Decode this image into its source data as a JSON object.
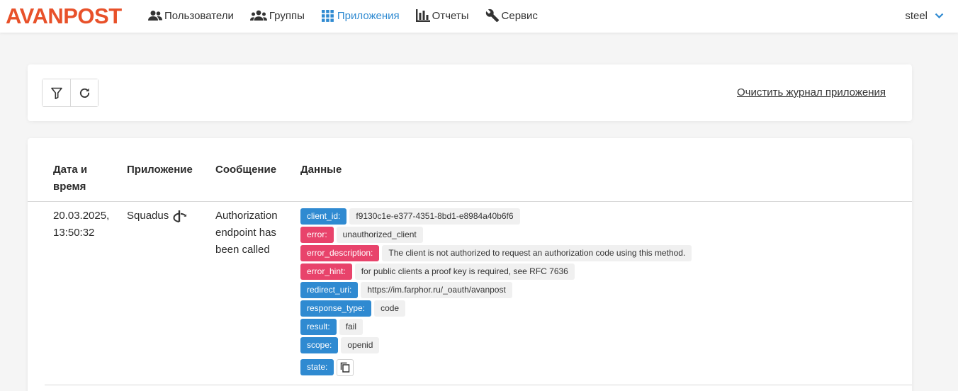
{
  "brand": {
    "logo_text": "AVANPOST",
    "color": "#e8512a"
  },
  "nav": {
    "items": [
      {
        "label": "Пользователи",
        "icon": "users-icon"
      },
      {
        "label": "Группы",
        "icon": "groups-icon"
      },
      {
        "label": "Приложения",
        "icon": "apps-grid-icon",
        "active": true
      },
      {
        "label": "Отчеты",
        "icon": "bar-chart-icon"
      },
      {
        "label": "Сервис",
        "icon": "wrench-icon"
      }
    ],
    "user": "steel",
    "accent": "#2f8ad1"
  },
  "toolbar": {
    "filter_icon": "filter-icon",
    "refresh_icon": "refresh-icon",
    "clear_link": "Очистить журнал приложения"
  },
  "table": {
    "headers": {
      "datetime_line1": "Дата и",
      "datetime_line2": "время",
      "app": "Приложение",
      "message": "Сообщение",
      "data": "Данные"
    },
    "rows": [
      {
        "date": "20.03.2025,",
        "time": "13:50:32",
        "app": "Squadus",
        "app_icon": "openid-icon",
        "message_lines": [
          "Authorization",
          "endpoint has",
          "been called"
        ],
        "data": [
          {
            "key": "client_id:",
            "value": "f9130c1e-e377-4351-8bd1-e8984a40b6f6",
            "kind": "blue"
          },
          {
            "key": "error:",
            "value": "unauthorized_client",
            "kind": "red"
          },
          {
            "key": "error_description:",
            "value": "The client is not authorized to request an authorization code using this method.",
            "kind": "red"
          },
          {
            "key": "error_hint:",
            "value": "for public clients a proof key is required, see RFC 7636",
            "kind": "red"
          },
          {
            "key": "redirect_uri:",
            "value": "https://im.farphor.ru/_oauth/avanpost",
            "kind": "blue"
          },
          {
            "key": "response_type:",
            "value": "code",
            "kind": "blue"
          },
          {
            "key": "result:",
            "value": "fail",
            "kind": "blue"
          },
          {
            "key": "scope:",
            "value": "openid",
            "kind": "blue"
          },
          {
            "key": "state:",
            "value": "",
            "kind": "blue",
            "copy_icon": "copy-icon"
          }
        ]
      }
    ]
  }
}
